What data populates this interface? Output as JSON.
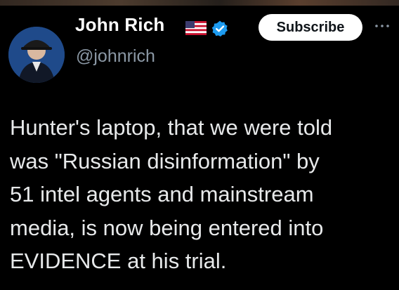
{
  "author": {
    "name": "John Rich",
    "handle": "@johnrich",
    "flag_icon": "us-flag-icon",
    "verified_icon": "verified-badge-icon",
    "verified_color": "#1d9bf0"
  },
  "actions": {
    "subscribe_label": "Subscribe",
    "more_icon": "more-options-icon"
  },
  "tweet": {
    "lines": [
      "Hunter's laptop, that we were told",
      "was \"Russian disinformation\" by",
      "51 intel agents and mainstream",
      "media, is now being entered into",
      "EVIDENCE at his trial."
    ]
  },
  "colors": {
    "background": "#000000",
    "text": "#e7e9ea",
    "secondary_text": "#8b98a5",
    "button_bg": "#ffffff"
  }
}
